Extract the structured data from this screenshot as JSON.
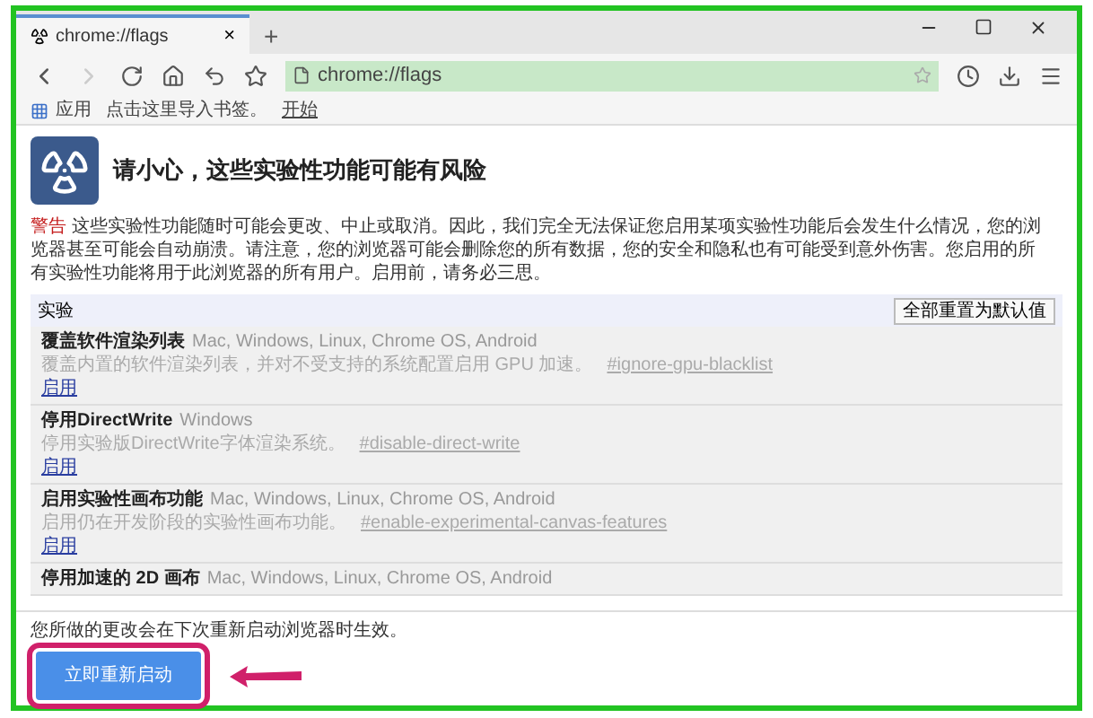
{
  "tab": {
    "title": "chrome://flags",
    "close": "×"
  },
  "new_tab": "+",
  "address_bar": {
    "value": "chrome://flags"
  },
  "bookmarks_bar": {
    "apps": "应用",
    "hint": "点击这里导入书签。",
    "link": "开始"
  },
  "warning": {
    "title": "请小心，这些实验性功能可能有风险",
    "label": "警告",
    "text": "这些实验性功能随时可能会更改、中止或取消。因此，我们完全无法保证您启用某项实验性功能后会发生什么情况，您的浏览器甚至可能会自动崩溃。请注意，您的浏览器可能会删除您的所有数据，您的安全和隐私也有可能受到意外伤害。您启用的所有实验性功能将用于此浏览器的所有用户。启用前，请务必三思。"
  },
  "experiments": {
    "heading": "实验",
    "reset_button": "全部重置为默认值",
    "items": [
      {
        "title": "覆盖软件渲染列表",
        "platforms": "Mac, Windows, Linux, Chrome OS, Android",
        "description": "覆盖内置的软件渲染列表，并对不受支持的系统配置启用 GPU 加速。",
        "flag": "#ignore-gpu-blacklist",
        "action": "启用"
      },
      {
        "title": "停用DirectWrite",
        "platforms": "Windows",
        "description": "停用实验版DirectWrite字体渲染系统。",
        "flag": "#disable-direct-write",
        "action": "启用"
      },
      {
        "title": "启用实验性画布功能",
        "platforms": "Mac, Windows, Linux, Chrome OS, Android",
        "description": "启用仍在开发阶段的实验性画布功能。",
        "flag": "#enable-experimental-canvas-features",
        "action": "启用"
      },
      {
        "title": "停用加速的 2D 画布",
        "platforms": "Mac, Windows, Linux, Chrome OS, Android"
      }
    ]
  },
  "footer": {
    "notice": "您所做的更改会在下次重新启动浏览器时生效。",
    "relaunch_button": "立即重新启动"
  }
}
